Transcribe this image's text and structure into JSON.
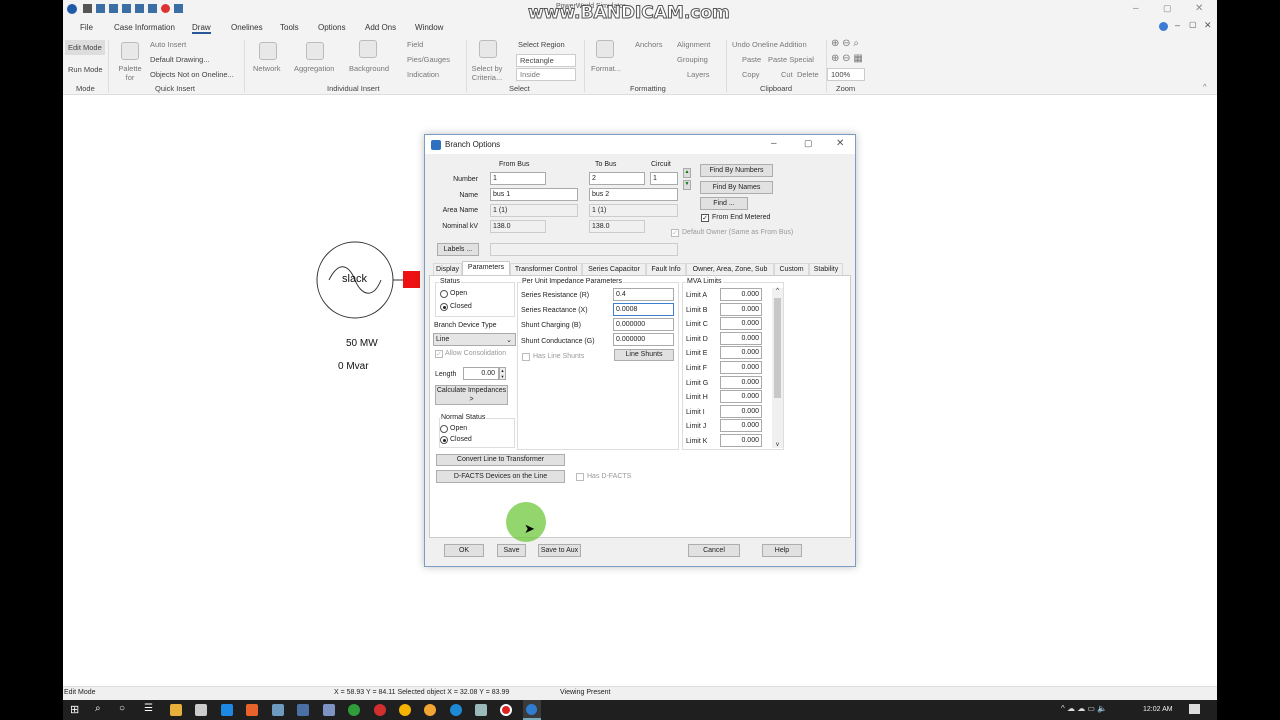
{
  "watermark": "www.BANDICAM.com",
  "app_title": "PowerWorld Simulator",
  "menu": [
    "File",
    "Case Information",
    "Draw",
    "Onelines",
    "Tools",
    "Options",
    "Add Ons",
    "Window"
  ],
  "menu_active": "Draw",
  "ribbon": {
    "mode": {
      "edit": "Edit Mode",
      "run": "Run Mode",
      "group": "Mode"
    },
    "quick_insert": {
      "palette": "Palette for",
      "auto_insert": "Auto Insert",
      "default_drawing": "Default Drawing...",
      "objects_not_on_oneline": "Objects Not on Oneline...",
      "group": "Quick Insert"
    },
    "individual_insert": {
      "network": "Network",
      "aggregation": "Aggregation",
      "background": "Background",
      "field": "Field",
      "pies_gauges": "Pies/Gauges",
      "indication": "Indication",
      "group": "Individual Insert"
    },
    "select": {
      "select_by_criteria": "Select by Criteria...",
      "select_region": "Select Region",
      "rectangle": "Rectangle",
      "inside": "Inside",
      "group": "Select"
    },
    "formatting": {
      "format": "Format...",
      "anchors": "Anchors",
      "alignment": "Alignment",
      "grouping": "Grouping",
      "layers": "Layers",
      "group": "Formatting"
    },
    "clipboard": {
      "undo": "Undo Oneline Addition",
      "paste": "Paste",
      "paste_special": "Paste Special",
      "copy": "Copy",
      "cut": "Cut",
      "delete": "Delete",
      "group": "Clipboard"
    },
    "zoom": {
      "level": "100%",
      "group": "Zoom"
    }
  },
  "oneline": {
    "generator_label": "slack",
    "mw": "50 MW",
    "mvar": "0 Mvar",
    "bus_color": "#ee1111"
  },
  "dialog": {
    "title": "Branch Options",
    "headers": {
      "from_bus": "From Bus",
      "to_bus": "To Bus",
      "circuit": "Circuit"
    },
    "row_labels": {
      "number": "Number",
      "name": "Name",
      "area_name": "Area Name",
      "nominal_kv": "Nominal kV"
    },
    "from": {
      "number": "1",
      "name": "bus 1",
      "area": "1 (1)",
      "kv": "138.0"
    },
    "to": {
      "number": "2",
      "name": "bus 2",
      "area": "1 (1)",
      "kv": "138.0"
    },
    "circuit": "1",
    "find_by_numbers": "Find By Numbers",
    "find_by_names": "Find By Names",
    "find": "Find ...",
    "from_end_metered": "From End Metered",
    "default_owner": "Default Owner (Same as From Bus)",
    "labels_button": "Labels ...",
    "labels_value": "",
    "tabs": [
      "Display",
      "Parameters",
      "Transformer Control",
      "Series Capacitor",
      "Fault Info",
      "Owner, Area, Zone, Sub",
      "Custom",
      "Stability"
    ],
    "active_tab": "Parameters",
    "params": {
      "status_title": "Status",
      "open": "Open",
      "closed": "Closed",
      "status_value": "Closed",
      "device_type_label": "Branch Device Type",
      "device_type": "Line",
      "allow_consolidation": "Allow Consolidation",
      "length_label": "Length",
      "length": "0.00",
      "calc_impedances": "Calculate Impedances >",
      "normal_status_title": "Normal Status",
      "normal_status_value": "Closed",
      "impedance_title": "Per Unit Impedance Parameters",
      "series_resistance_label": "Series Resistance (R)",
      "series_resistance": "0.4",
      "series_reactance_label": "Series Reactance (X)",
      "series_reactance": "0.0008",
      "shunt_charging_label": "Shunt Charging (B)",
      "shunt_charging": "0.000000",
      "shunt_conductance_label": "Shunt Conductance (G)",
      "shunt_conductance": "0.000000",
      "has_line_shunts": "Has Line Shunts",
      "line_shunts": "Line Shunts",
      "mva_title": "MVA Limits",
      "limits": [
        {
          "label": "Limit A",
          "value": "0.000"
        },
        {
          "label": "Limit B",
          "value": "0.000"
        },
        {
          "label": "Limit C",
          "value": "0.000"
        },
        {
          "label": "Limit D",
          "value": "0.000"
        },
        {
          "label": "Limit E",
          "value": "0.000"
        },
        {
          "label": "Limit F",
          "value": "0.000"
        },
        {
          "label": "Limit G",
          "value": "0.000"
        },
        {
          "label": "Limit H",
          "value": "0.000"
        },
        {
          "label": "Limit I",
          "value": "0.000"
        },
        {
          "label": "Limit J",
          "value": "0.000"
        },
        {
          "label": "Limit K",
          "value": "0.000"
        }
      ],
      "convert_line": "Convert Line to Transformer",
      "dfacts": "D-FACTS Devices on the Line",
      "has_dfacts": "Has D-FACTS"
    },
    "buttons": {
      "ok": "OK",
      "save": "Save",
      "save_to_aux": "Save to Aux",
      "cancel": "Cancel",
      "help": "Help"
    }
  },
  "statusbar": {
    "mode": "Edit Mode",
    "coords": "X = 58.93 Y = 84.11 Selected object X = 32.08 Y = 83.99",
    "viewing": "Viewing Present"
  },
  "taskbar": {
    "time": "12:02 AM"
  }
}
